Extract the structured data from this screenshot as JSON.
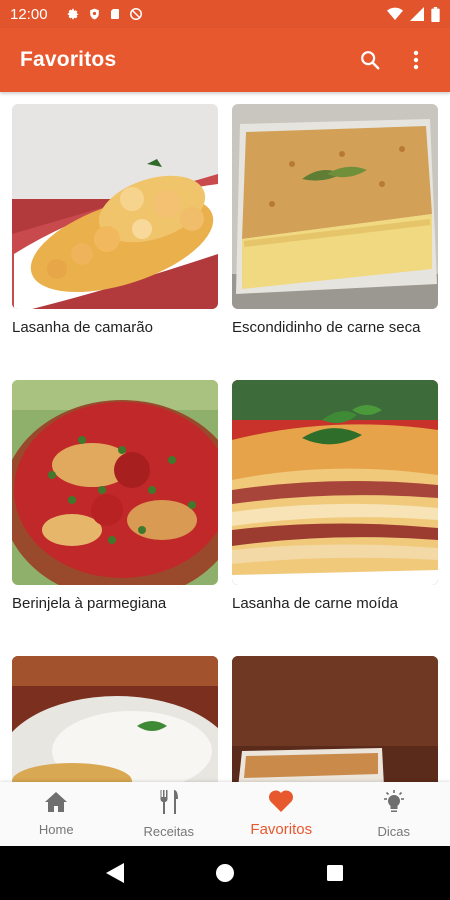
{
  "status_bar": {
    "time": "12:00",
    "icons": [
      "gear-icon",
      "shield-icon",
      "sd-card-icon",
      "no-disturb-icon"
    ],
    "right_icons": [
      "wifi-icon",
      "signal-icon",
      "battery-icon"
    ]
  },
  "app_bar": {
    "title": "Favoritos",
    "actions": [
      "search-icon",
      "more-vertical-icon"
    ],
    "color": "#e8582e"
  },
  "recipes": [
    {
      "title": "Lasanha de camarão"
    },
    {
      "title": "Escondidinho de carne seca"
    },
    {
      "title": "Berinjela à parmegiana"
    },
    {
      "title": "Lasanha de carne moída"
    },
    {
      "title": ""
    },
    {
      "title": ""
    }
  ],
  "bottom_nav": {
    "items": [
      {
        "label": "Home",
        "icon": "home-icon"
      },
      {
        "label": "Receitas",
        "icon": "fork-knife-icon"
      },
      {
        "label": "Favoritos",
        "icon": "heart-icon",
        "active": true
      },
      {
        "label": "Dicas",
        "icon": "lightbulb-icon"
      }
    ],
    "active_color": "#e8582e"
  },
  "system_nav": [
    "back-icon",
    "home-circle-icon",
    "recents-icon"
  ]
}
